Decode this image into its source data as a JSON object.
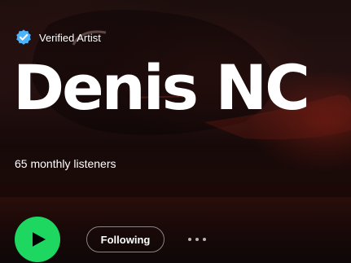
{
  "artist": {
    "verified_label": "Verified Artist",
    "name": "Denis NC",
    "monthly_listeners": "65 monthly listeners"
  },
  "actions": {
    "play_icon": "play-icon",
    "follow_label": "Following",
    "more_icon": "more-options-icon"
  },
  "colors": {
    "accent_green": "#1ed760",
    "verified_blue": "#4cb3ff",
    "hero_red": "#8a1f14",
    "text": "#ffffff"
  }
}
